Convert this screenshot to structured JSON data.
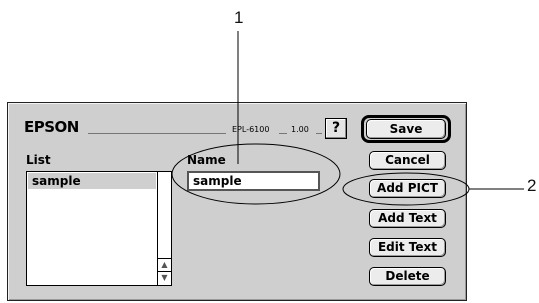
{
  "callouts": [
    "1",
    "2"
  ],
  "dialog": {
    "brand": "EPSON",
    "model": "EPL-6100",
    "version": "1.00",
    "help_glyph": "?",
    "list_label": "List",
    "list_items": [
      "sample"
    ],
    "name_label": "Name",
    "name_value": "sample",
    "buttons": {
      "save": "Save",
      "cancel": "Cancel",
      "add_pict": "Add PICT",
      "add_text": "Add Text",
      "edit_text": "Edit Text",
      "delete": "Delete"
    },
    "scroll_up_icon": "triangle-up",
    "scroll_down_icon": "triangle-down"
  }
}
